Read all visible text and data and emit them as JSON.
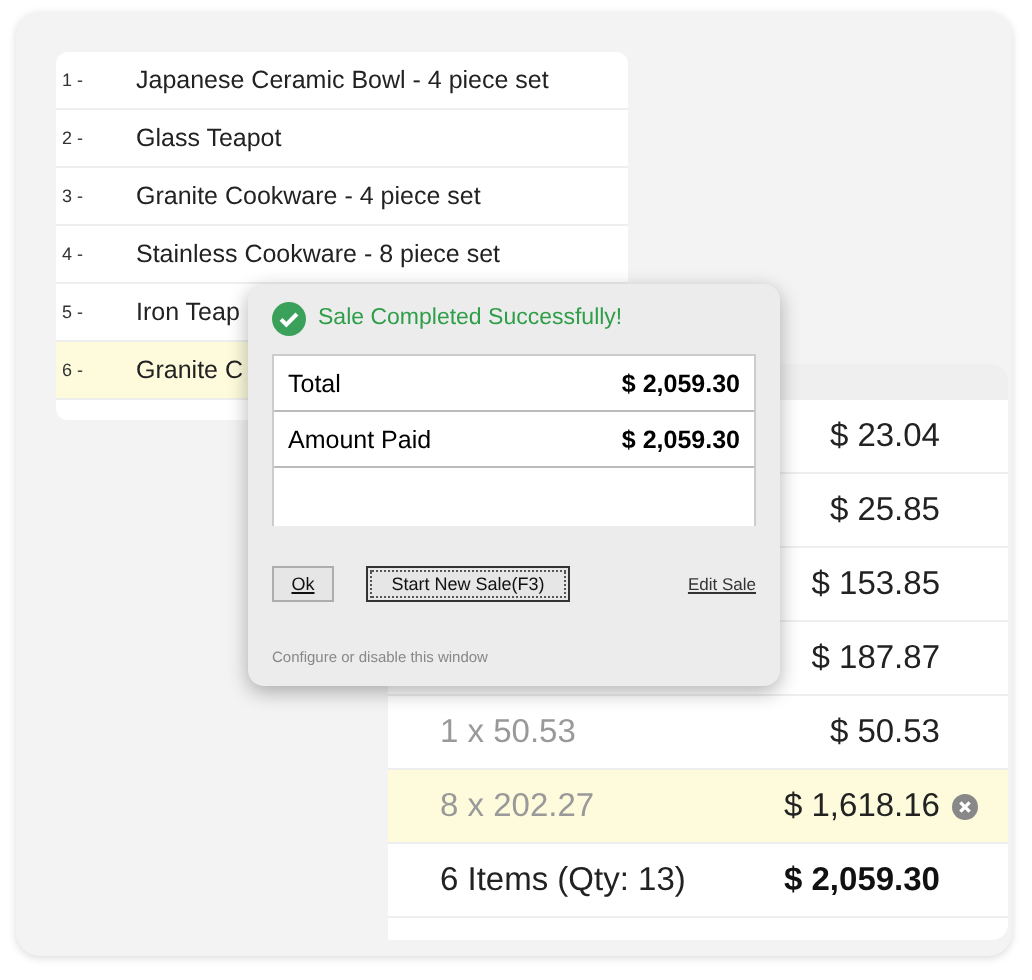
{
  "items": [
    {
      "number": "1 -",
      "name": "Japanese Ceramic Bowl - 4 piece set",
      "selected": false
    },
    {
      "number": "2 -",
      "name": "Glass Teapot",
      "selected": false
    },
    {
      "number": "3 -",
      "name": "Granite Cookware - 4 piece set",
      "selected": false
    },
    {
      "number": "4 -",
      "name": "Stainless Cookware - 8 piece set",
      "selected": false
    },
    {
      "number": "5 -",
      "name": "Iron Teap",
      "selected": false
    },
    {
      "number": "6 -",
      "name": "Granite C",
      "selected": true
    }
  ],
  "lines": [
    {
      "amount": "$ 23.04",
      "selected": false
    },
    {
      "amount": "$ 25.85",
      "selected": false
    },
    {
      "amount": "$ 153.85",
      "selected": false
    },
    {
      "amount": "$ 187.87",
      "selected": false
    },
    {
      "quantity": "1 x 50.53",
      "amount": "$ 50.53",
      "selected": false
    },
    {
      "quantity": "8 x 202.27",
      "amount": "$ 1,618.16",
      "selected": true
    }
  ],
  "summary": {
    "count": "6 Items (Qty: 13)",
    "total": "$ 2,059.30"
  },
  "dialog": {
    "title": "Sale Completed Successfully!",
    "rows": [
      {
        "label": "Total",
        "value": "$ 2,059.30"
      },
      {
        "label": "Amount Paid",
        "value": "$ 2,059.30"
      }
    ],
    "ok_button": "Ok",
    "new_sale_button": "Start New Sale(F3)",
    "edit_link": "Edit Sale",
    "footer": "Configure or disable this window"
  }
}
